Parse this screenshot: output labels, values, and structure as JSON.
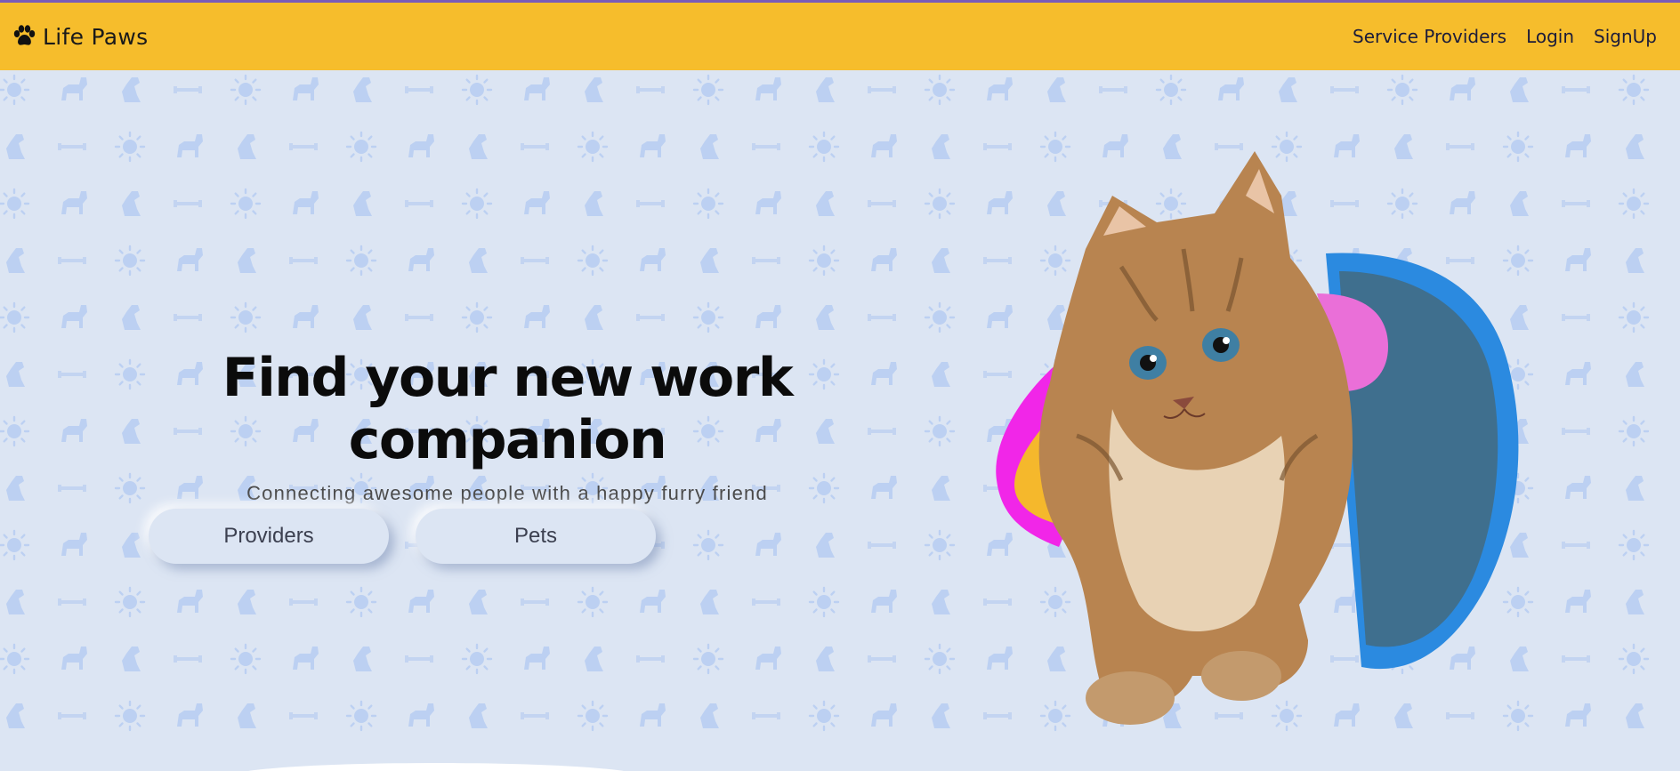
{
  "navbar": {
    "brand": "Life Paws",
    "brand_icon": "paw-icon",
    "links": [
      {
        "label": "Service Providers"
      },
      {
        "label": "Login"
      },
      {
        "label": "SignUp"
      }
    ],
    "background": "#f6bd2c"
  },
  "hero": {
    "title": "Find your new work companion",
    "subtitle": "Connecting awesome people with a happy furry friend",
    "buttons": [
      {
        "label": "Providers"
      },
      {
        "label": "Pets"
      }
    ],
    "image": "kitten-illustration"
  },
  "theme": {
    "page_background": "#dce5f3",
    "pattern_color": "#b9cdf0",
    "blob_colors": [
      "#f126e8",
      "#f5b82c",
      "#2b8ae0"
    ]
  }
}
